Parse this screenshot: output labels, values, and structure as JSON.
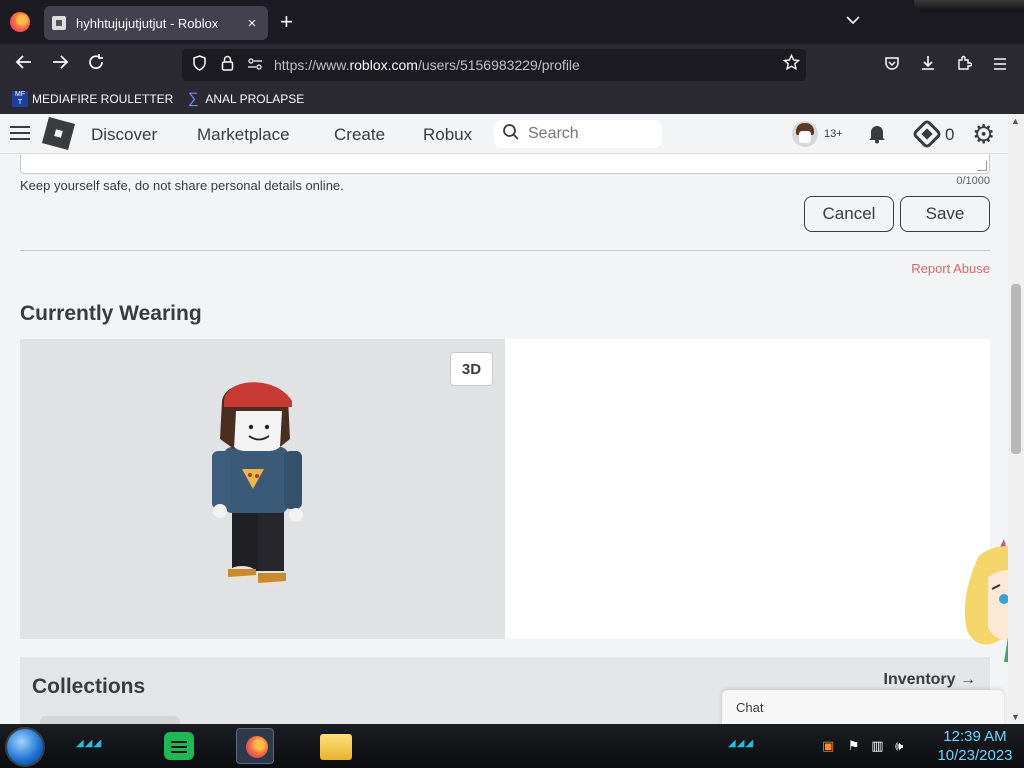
{
  "browser": {
    "tab_title": "hyhhtujujutjutjut - Roblox",
    "tab_close": "×",
    "new_tab": "+",
    "tabs_list": "⌄",
    "url_prefix": "https://www.",
    "url_domain": "roblox.com",
    "url_path": "/users/5156983229/profile",
    "bookmarks": [
      {
        "label": "MEDIAFIRE ROULETTER",
        "icon": "mediafire-icon"
      },
      {
        "label": "ANAL PROLAPSE",
        "icon": "sigma-icon"
      }
    ]
  },
  "header": {
    "nav": [
      "Discover",
      "Marketplace",
      "Create",
      "Robux"
    ],
    "search_placeholder": "Search",
    "age_badge": "13+",
    "robux_balance": "0"
  },
  "profile": {
    "safety_notice": "Keep yourself safe, do not share personal details online.",
    "char_counter": "0/1000",
    "cancel_label": "Cancel",
    "save_label": "Save",
    "report_abuse": "Report Abuse",
    "currently_wearing": "Currently Wearing",
    "toggle_3d": "3D",
    "collections_title": "Collections",
    "inventory_link": "Inventory →"
  },
  "chat": {
    "label": "Chat"
  },
  "taskbar": {
    "time": "12:39 AM",
    "date": "10/23/2023"
  },
  "colors": {
    "page_bg": "#f2f4f5",
    "text": "#393b3d",
    "report_red": "#d86868",
    "browser_dark": "#1c1b22"
  }
}
